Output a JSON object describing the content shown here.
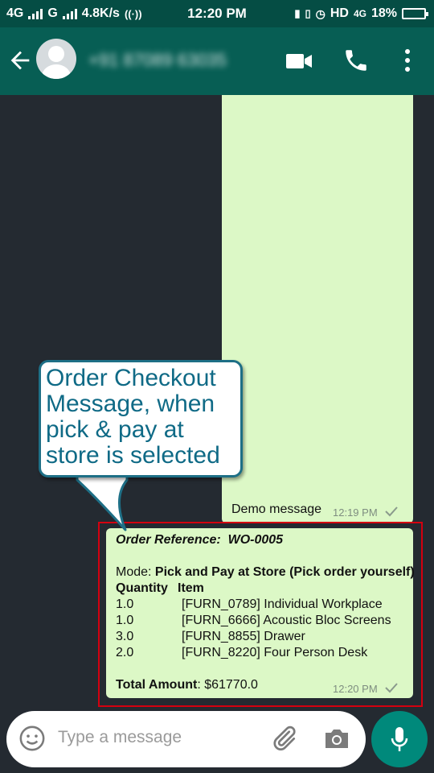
{
  "status_bar": {
    "network_left": "4G",
    "network_right": "G",
    "speed": "4.8K/s",
    "time": "12:20 PM",
    "hd": "HD",
    "lte": "4G",
    "battery": "18%"
  },
  "header": {
    "contact_name": "+91 87089 63035",
    "icons": [
      "back-arrow-icon",
      "video-call-icon",
      "voice-call-icon",
      "more-options-icon"
    ]
  },
  "messages": {
    "demo": {
      "text": "Demo message",
      "time": "12:19 PM"
    },
    "order": {
      "ref_label": "Order Reference:",
      "ref_value": "WO-0005",
      "mode_label": "Mode:",
      "mode_value": "Pick and Pay at Store (Pick order yourself)",
      "col_quantity": "Quantity",
      "col_item": "Item",
      "rows": [
        {
          "qty": "1.0",
          "item": "[FURN_0789] Individual Workplace"
        },
        {
          "qty": "1.0",
          "item": "[FURN_6666] Acoustic Bloc Screens"
        },
        {
          "qty": "3.0",
          "item": "[FURN_8855] Drawer"
        },
        {
          "qty": "2.0",
          "item": "[FURN_8220] Four Person Desk"
        }
      ],
      "total_label": "Total Amount",
      "total_value": ": $61770.0",
      "time": "12:20 PM"
    }
  },
  "callout": {
    "text": "Order Checkout Message, when pick & pay at store is selected"
  },
  "input": {
    "placeholder": "Type a message"
  },
  "colors": {
    "header": "#075e54",
    "status_bar": "#054d44",
    "bubble": "#dcf8c6",
    "background": "#242a31",
    "highlight": "#d4000f",
    "callout_text": "#0f6a86",
    "mic_button": "#00897b"
  }
}
